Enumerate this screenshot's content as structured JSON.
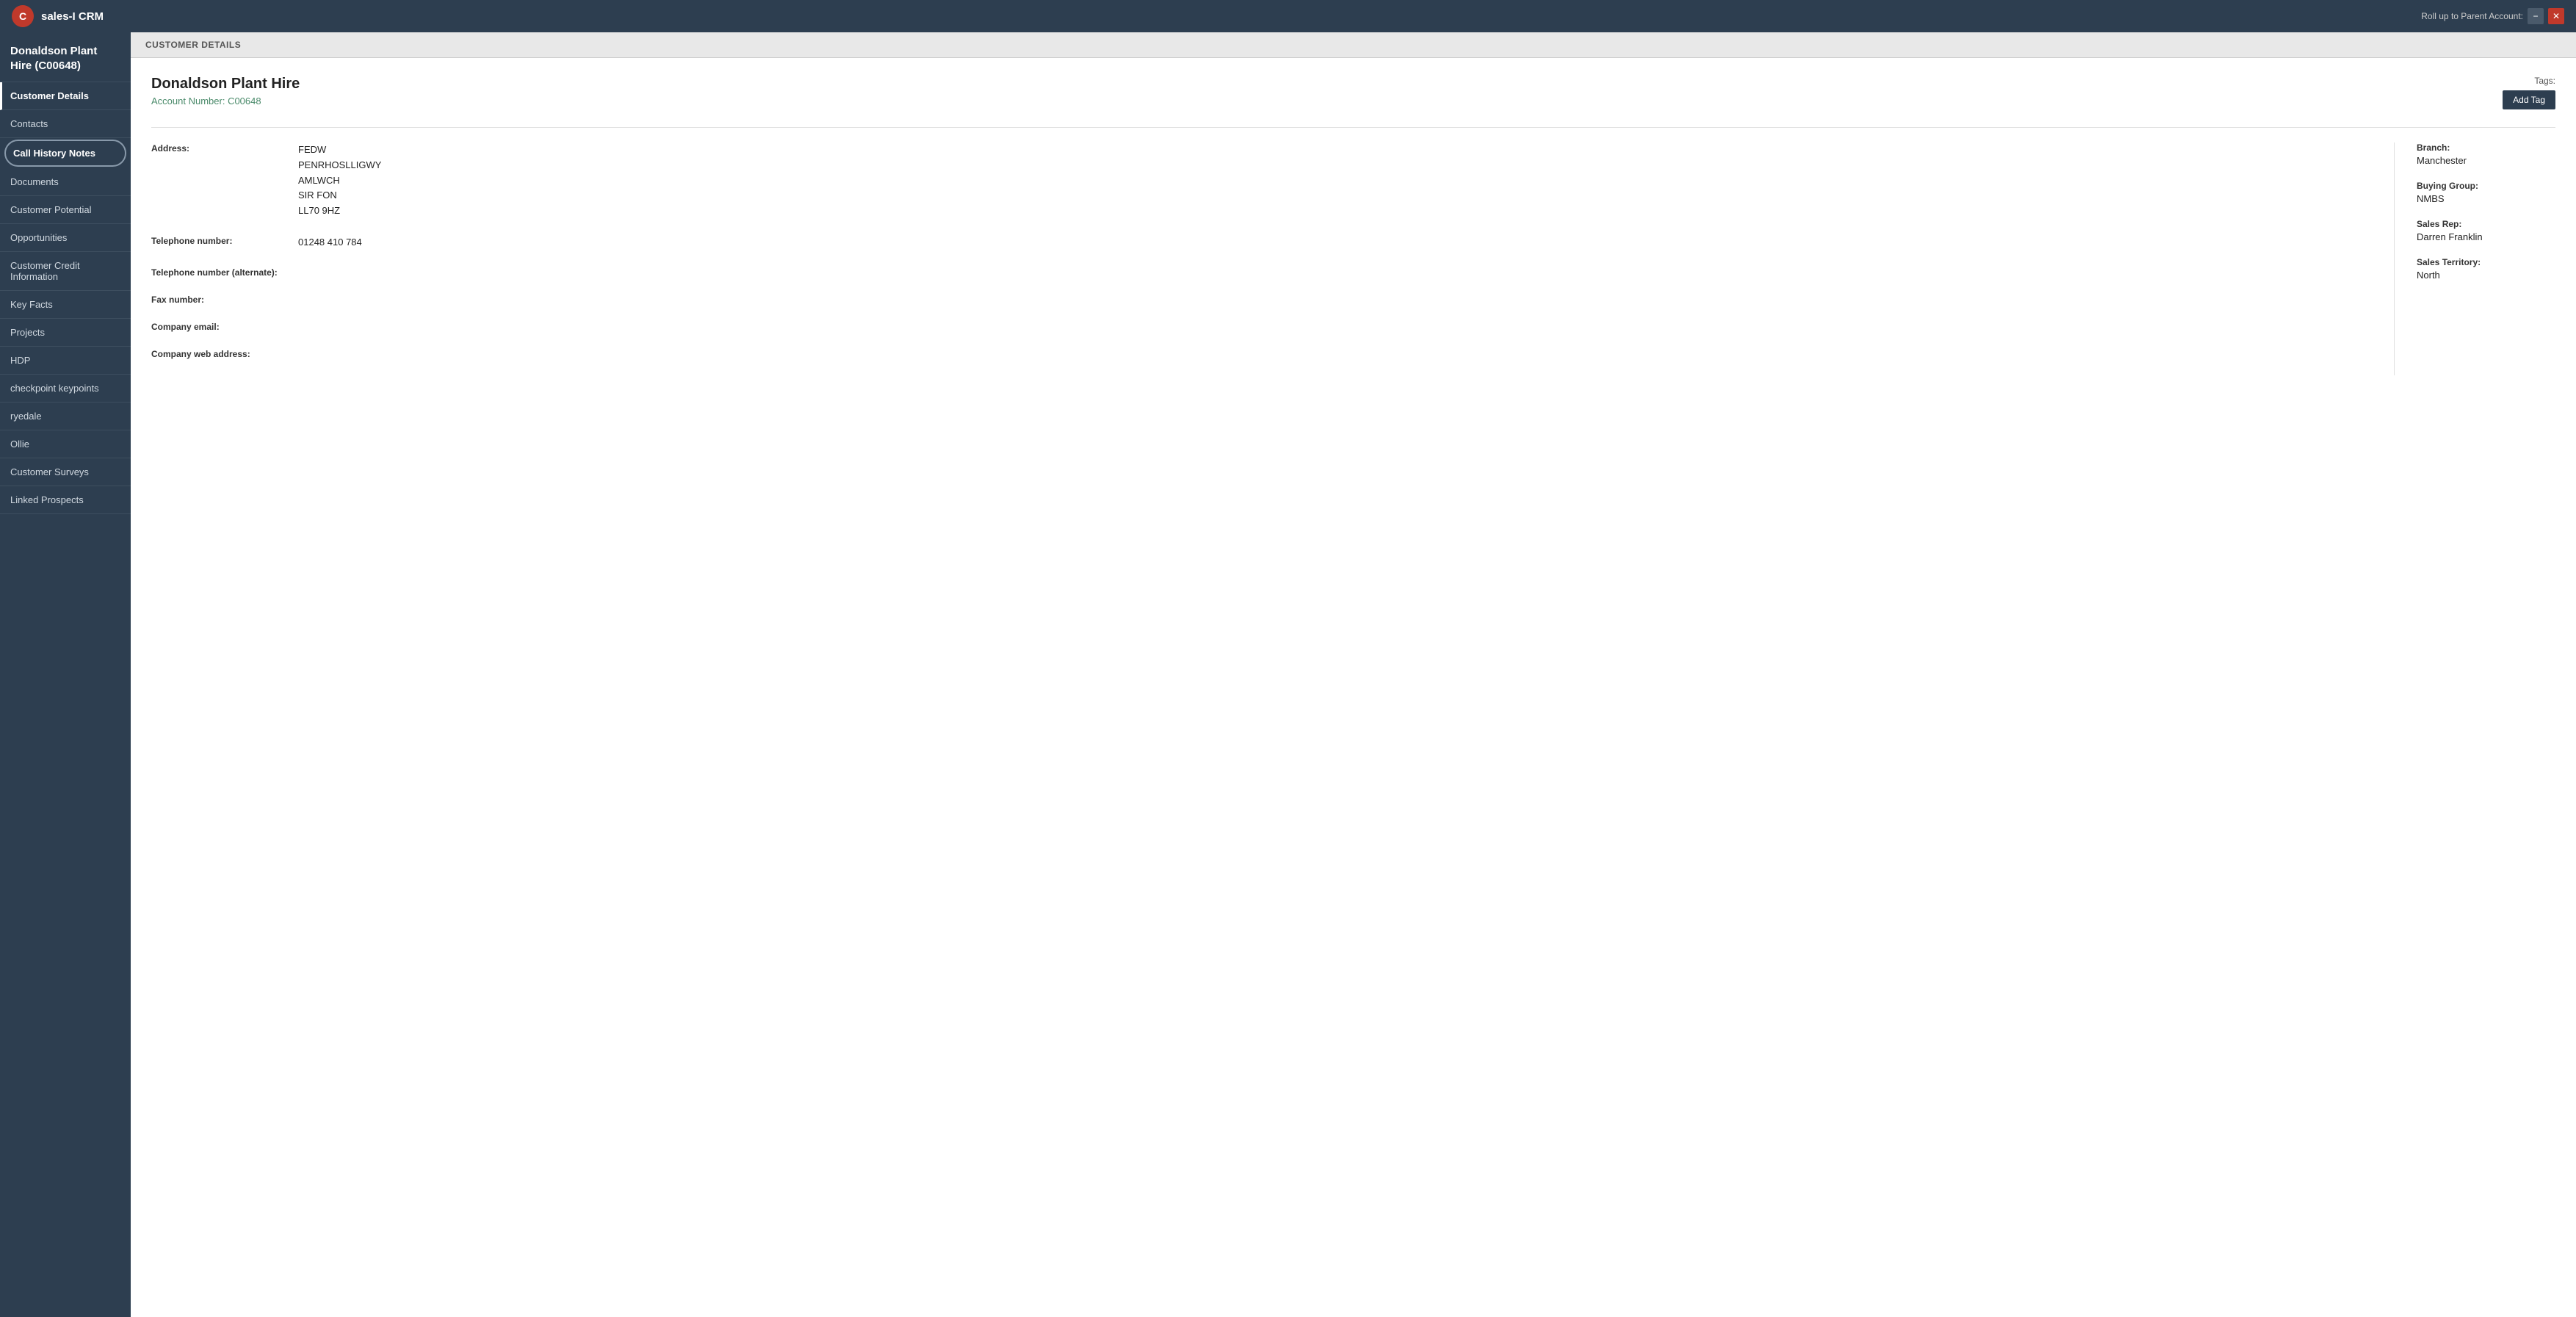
{
  "topbar": {
    "logo_text": "C",
    "app_title": "sales-I CRM",
    "roll_up_label": "Roll up to Parent Account:",
    "minimize_label": "−",
    "close_label": "✕"
  },
  "sidebar": {
    "company_name": "Donaldson Plant Hire (C00648)",
    "items": [
      {
        "id": "customer-details",
        "label": "Customer Details",
        "active": true,
        "highlighted": false
      },
      {
        "id": "contacts",
        "label": "Contacts",
        "active": false,
        "highlighted": false
      },
      {
        "id": "call-history-notes",
        "label": "Call History Notes",
        "active": false,
        "highlighted": true
      },
      {
        "id": "documents",
        "label": "Documents",
        "active": false,
        "highlighted": false
      },
      {
        "id": "customer-potential",
        "label": "Customer Potential",
        "active": false,
        "highlighted": false
      },
      {
        "id": "opportunities",
        "label": "Opportunities",
        "active": false,
        "highlighted": false
      },
      {
        "id": "customer-credit-information",
        "label": "Customer Credit Information",
        "active": false,
        "highlighted": false
      },
      {
        "id": "key-facts",
        "label": "Key Facts",
        "active": false,
        "highlighted": false
      },
      {
        "id": "projects",
        "label": "Projects",
        "active": false,
        "highlighted": false
      },
      {
        "id": "hdp",
        "label": "HDP",
        "active": false,
        "highlighted": false
      },
      {
        "id": "checkpoint-keypoints",
        "label": "checkpoint keypoints",
        "active": false,
        "highlighted": false
      },
      {
        "id": "ryedale",
        "label": "ryedale",
        "active": false,
        "highlighted": false
      },
      {
        "id": "ollie",
        "label": "Ollie",
        "active": false,
        "highlighted": false
      },
      {
        "id": "customer-surveys",
        "label": "Customer Surveys",
        "active": false,
        "highlighted": false
      },
      {
        "id": "linked-prospects",
        "label": "Linked Prospects",
        "active": false,
        "highlighted": false
      }
    ]
  },
  "subheader": {
    "label": "CUSTOMER DETAILS"
  },
  "customer": {
    "name": "Donaldson Plant Hire",
    "account_number_label": "Account Number:",
    "account_number": "C00648",
    "tags_label": "Tags:",
    "add_tag_button": "Add Tag"
  },
  "address": {
    "label": "Address:",
    "lines": [
      "FEDW",
      "PENRHOSLLIGWY",
      "AMLWCH",
      "SIR FON",
      "LL70 9HZ"
    ]
  },
  "telephone": {
    "label": "Telephone number:",
    "value": "01248 410 784"
  },
  "telephone_alt": {
    "label": "Telephone number (alternate):",
    "value": ""
  },
  "fax": {
    "label": "Fax number:",
    "value": ""
  },
  "company_email": {
    "label": "Company email:",
    "value": ""
  },
  "company_web": {
    "label": "Company web address:",
    "value": ""
  },
  "side_info": {
    "branch_label": "Branch:",
    "branch_value": "Manchester",
    "buying_group_label": "Buying Group:",
    "buying_group_value": "NMBS",
    "sales_rep_label": "Sales Rep:",
    "sales_rep_value": "Darren Franklin",
    "sales_territory_label": "Sales Territory:",
    "sales_territory_value": "North"
  }
}
